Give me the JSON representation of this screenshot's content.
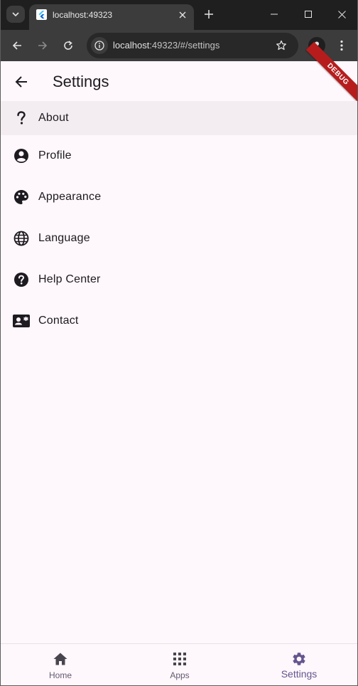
{
  "browser": {
    "tab_title": "localhost:49323",
    "url_host": "localhost",
    "url_rest": ":49323/#/settings"
  },
  "app": {
    "title": "Settings",
    "debug_banner": "DEBUG",
    "menu": [
      {
        "label": "About",
        "icon": "question-mark-icon",
        "selected": true
      },
      {
        "label": "Profile",
        "icon": "account-circle-icon"
      },
      {
        "label": "Appearance",
        "icon": "palette-icon"
      },
      {
        "label": "Language",
        "icon": "globe-icon"
      },
      {
        "label": "Help Center",
        "icon": "help-circle-icon"
      },
      {
        "label": "Contact",
        "icon": "contact-card-icon"
      }
    ],
    "bottom_nav": [
      {
        "label": "Home",
        "icon": "home-icon"
      },
      {
        "label": "Apps",
        "icon": "apps-grid-icon"
      },
      {
        "label": "Settings",
        "icon": "gear-icon",
        "active": true
      }
    ]
  },
  "colors": {
    "background": "#fef7fb",
    "accent": "#65558f",
    "selected_row": "#f3edf1",
    "debug_banner": "#b71c1c"
  }
}
